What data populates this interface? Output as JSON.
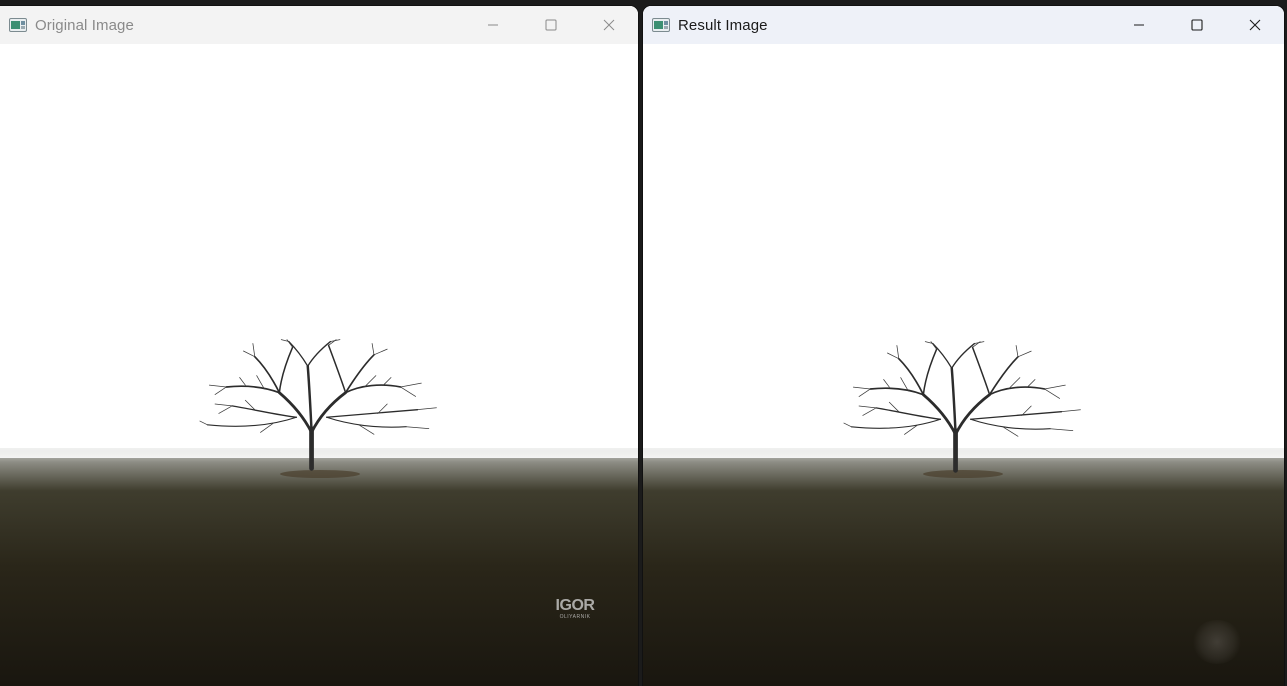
{
  "windows": {
    "left": {
      "title": "Original Image",
      "icon": "app-window-icon",
      "buttons": {
        "minimize": "minimize-icon",
        "maximize": "maximize-icon",
        "close": "close-icon"
      },
      "image": {
        "subject": "lone-tree-in-fog",
        "watermark": {
          "main": "IGOR",
          "sub": "OLIYARNIK"
        }
      }
    },
    "right": {
      "title": "Result Image",
      "icon": "app-window-icon",
      "buttons": {
        "minimize": "minimize-icon",
        "maximize": "maximize-icon",
        "close": "close-icon"
      },
      "image": {
        "subject": "lone-tree-in-fog"
      }
    }
  },
  "colors": {
    "titlebar_inactive": "#f3f3f3",
    "titlebar_active": "#eef1f8",
    "sky": "#ffffff",
    "field_dark": "#1f1b12",
    "tree": "#2c2c2c"
  }
}
